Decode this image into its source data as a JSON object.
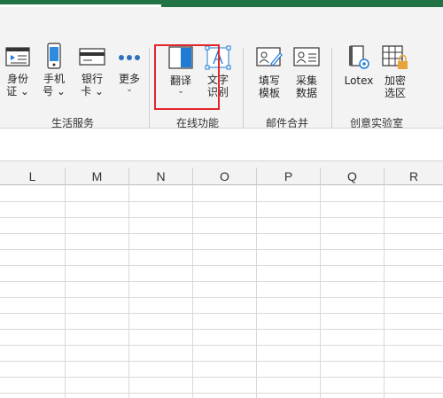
{
  "ribbon": {
    "buttons": [
      {
        "id": "id-card",
        "label": "身份\n证",
        "chev": "⌄"
      },
      {
        "id": "phone",
        "label": "手机\n号",
        "chev": "⌄"
      },
      {
        "id": "bank-card",
        "label": "银行\n卡",
        "chev": "⌄"
      },
      {
        "id": "more",
        "label": "更多",
        "chev": "⌄"
      },
      {
        "id": "translate",
        "label": "翻译",
        "chev": "⌄"
      },
      {
        "id": "ocr",
        "label": "文字\n识别"
      },
      {
        "id": "fill-template",
        "label": "填写\n模板"
      },
      {
        "id": "collect-data",
        "label": "采集\n数据"
      },
      {
        "id": "lotex",
        "label": "Lotex"
      },
      {
        "id": "encrypt-area",
        "label": "加密\n选区"
      }
    ],
    "groups": [
      "生活服务",
      "在线功能",
      "邮件合并",
      "创意实验室"
    ]
  },
  "sheet": {
    "columns": [
      "L",
      "M",
      "N",
      "O",
      "P",
      "Q",
      "R"
    ]
  },
  "colors": {
    "brand_green": "#217346",
    "highlight_red": "#e0262a",
    "icon_blue": "#1f7bd6"
  }
}
